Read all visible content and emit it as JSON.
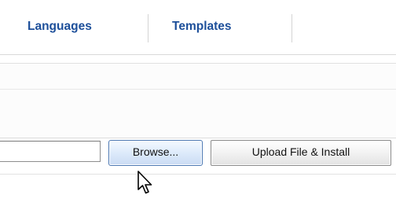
{
  "tabs": {
    "languages": "Languages",
    "templates": "Templates"
  },
  "upload": {
    "file_value": "",
    "browse_label": "Browse...",
    "install_label": "Upload File & Install"
  },
  "cursor": {
    "icon": "arrow-pointer-icon"
  },
  "colors": {
    "tab_text": "#1d4f9a",
    "browse_border": "#4d79b3",
    "browse_fill": "#dbe9fa"
  }
}
